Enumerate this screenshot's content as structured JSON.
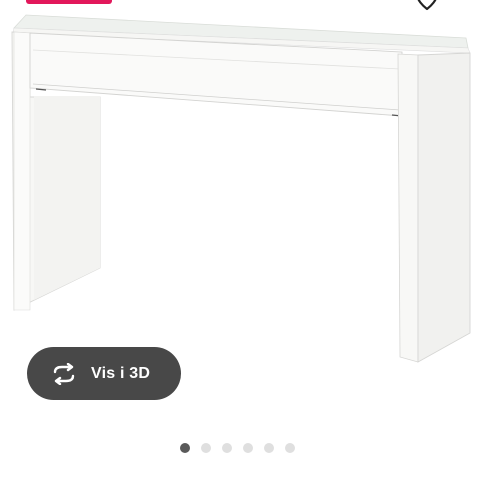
{
  "product": {
    "view_3d_label": "Vis i 3D",
    "image_icon": "desk-product-image"
  },
  "badge": {
    "color": "#e2185b"
  },
  "favorite": {
    "icon": "heart-icon"
  },
  "carousel": {
    "count": 6,
    "active_index": 0
  },
  "colors": {
    "pill_background": "#484848",
    "dot_active": "#595959",
    "dot_inactive": "#dfdfdf"
  }
}
